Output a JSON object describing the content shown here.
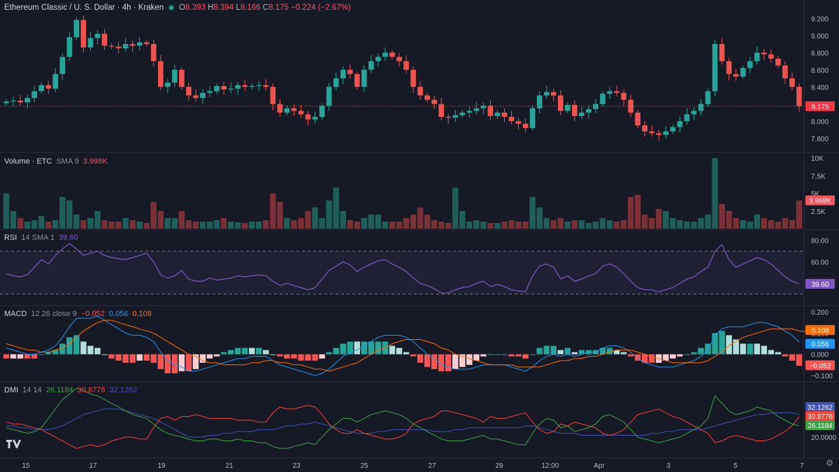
{
  "header": {
    "symbol": "Ethereum Classic / U. S. Dollar · 4h · Kraken",
    "o_label": "O",
    "o_value": "8.393",
    "h_label": "H",
    "h_value": "8.394",
    "l_label": "L",
    "l_value": "8.166",
    "c_label": "C",
    "c_value": "8.175",
    "change": "−0.224 (−2.67%)"
  },
  "volume_legend": {
    "name": "Volume · ETC",
    "param": "SMA 9",
    "value": "3.998K"
  },
  "rsi_legend": {
    "name": "RSI",
    "param": "14 SMA 1",
    "value": "39.60"
  },
  "macd_legend": {
    "name": "MACD",
    "param": "12 26 close 9",
    "v1": "−0.052",
    "v2": "0.056",
    "v3": "0.108"
  },
  "dmi_legend": {
    "name": "DMI",
    "param": "14 14",
    "v1": "26.1184",
    "v2": "30.8776",
    "v3": "32.1262"
  },
  "colors": {
    "background": "#161a25",
    "up": "#26a69a",
    "down": "#ef5350",
    "up_vol": "#1f5f5a",
    "down_vol": "#7b3038",
    "rsi": "#7e57c2",
    "macd": "#2196f3",
    "signal": "#ff6d00",
    "hist_up": "#26a69a",
    "hist_up_weak": "#b2dfdb",
    "hist_dn": "#ff5252",
    "hist_dn_weak": "#ffcdd2",
    "dmi_plus": "#43a047",
    "dmi_minus": "#f44336",
    "adx": "#3f51b5"
  },
  "chart_data": [
    {
      "type": "candlestick",
      "title": "Ethereum Classic / U. S. Dollar · 4h · Kraken",
      "ylim": [
        7.7,
        9.3
      ],
      "yticks": [
        "9.200",
        "9.000",
        "8.800",
        "8.600",
        "8.400",
        "8.200",
        "8.000",
        "7.800"
      ],
      "last_price": "8.175",
      "x_labels": [
        "15",
        "17",
        "19",
        "21",
        "23",
        "25",
        "27",
        "29",
        "12:00",
        "Apr",
        "3",
        "5",
        "7"
      ],
      "close": [
        8.23,
        8.24,
        8.22,
        8.27,
        8.35,
        8.42,
        8.38,
        8.55,
        8.75,
        8.98,
        9.18,
        8.86,
        8.97,
        9.02,
        8.88,
        8.87,
        8.85,
        8.9,
        8.88,
        8.92,
        8.9,
        8.7,
        8.4,
        8.45,
        8.6,
        8.4,
        8.3,
        8.27,
        8.33,
        8.35,
        8.41,
        8.37,
        8.38,
        8.42,
        8.4,
        8.41,
        8.42,
        8.4,
        8.2,
        8.1,
        8.15,
        8.12,
        8.08,
        8.02,
        8.05,
        8.18,
        8.4,
        8.5,
        8.6,
        8.55,
        8.4,
        8.6,
        8.7,
        8.75,
        8.8,
        8.75,
        8.7,
        8.6,
        8.4,
        8.3,
        8.25,
        8.2,
        8.05,
        8.04,
        8.07,
        8.1,
        8.12,
        8.15,
        8.18,
        8.06,
        8.1,
        8.05,
        8.0,
        7.97,
        7.92,
        8.15,
        8.3,
        8.34,
        8.3,
        8.12,
        8.19,
        8.06,
        8.1,
        8.14,
        8.2,
        8.32,
        8.35,
        8.33,
        8.25,
        8.1,
        7.95,
        7.88,
        7.86,
        7.84,
        7.88,
        7.93,
        8.0,
        8.08,
        8.12,
        8.2,
        8.35,
        8.9,
        8.7,
        8.55,
        8.52,
        8.62,
        8.7,
        8.8,
        8.78,
        8.73,
        8.65,
        8.5,
        8.4,
        8.175
      ],
      "volume_max_k": 10.0,
      "volume_k": [
        5.0,
        2.5,
        1.5,
        1.0,
        1.2,
        1.8,
        1.0,
        1.2,
        4.5,
        4.0,
        2.0,
        1.2,
        1.5,
        2.5,
        1.2,
        1.0,
        1.0,
        1.5,
        1.2,
        1.0,
        0.8,
        3.8,
        2.5,
        1.5,
        1.5,
        2.5,
        1.2,
        1.0,
        1.0,
        1.0,
        1.2,
        1.5,
        1.0,
        0.9,
        0.8,
        1.0,
        1.0,
        1.2,
        5.0,
        3.8,
        1.5,
        1.2,
        1.5,
        2.5,
        3.0,
        1.5,
        4.0,
        5.8,
        2.5,
        1.2,
        1.0,
        1.5,
        2.0,
        2.0,
        1.0,
        1.0,
        1.0,
        1.5,
        2.0,
        3.0,
        2.0,
        1.2,
        1.0,
        0.8,
        5.8,
        2.5,
        1.0,
        1.2,
        1.0,
        0.8,
        0.8,
        1.0,
        1.2,
        1.0,
        1.0,
        4.5,
        3.0,
        1.5,
        1.2,
        1.5,
        1.0,
        1.2,
        1.2,
        0.8,
        1.0,
        1.5,
        1.2,
        1.0,
        1.2,
        4.5,
        4.8,
        2.0,
        1.5,
        2.8,
        2.5,
        1.5,
        1.2,
        1.0,
        1.0,
        1.5,
        2.0,
        10.0,
        3.5,
        2.5,
        1.5,
        1.2,
        1.0,
        2.0,
        1.5,
        1.2,
        1.0,
        1.5,
        1.2,
        3.998
      ],
      "volume_yticks": [
        "10K",
        "7.5K",
        "5K",
        "2.5K"
      ]
    },
    {
      "type": "line",
      "name": "RSI",
      "ylim": [
        20,
        85
      ],
      "yticks": [
        "80.00",
        "60.00"
      ],
      "bands": [
        30,
        70
      ],
      "values": [
        49,
        47,
        46,
        48,
        55,
        62,
        58,
        66,
        72,
        77,
        72,
        66,
        68,
        70,
        66,
        64,
        63,
        62,
        64,
        66,
        68,
        60,
        48,
        45,
        47,
        52,
        44,
        42,
        42,
        45,
        43,
        44,
        45,
        47,
        46,
        47,
        48,
        47,
        42,
        38,
        40,
        38,
        36,
        34,
        36,
        44,
        52,
        56,
        60,
        57,
        51,
        55,
        58,
        61,
        62,
        58,
        55,
        51,
        45,
        40,
        38,
        35,
        31,
        31,
        34,
        36,
        37,
        40,
        42,
        37,
        39,
        37,
        34,
        33,
        32,
        47,
        56,
        58,
        55,
        44,
        47,
        42,
        44,
        47,
        49,
        56,
        58,
        55,
        49,
        42,
        36,
        34,
        34,
        32,
        34,
        36,
        40,
        44,
        46,
        51,
        55,
        70,
        76,
        62,
        55,
        58,
        61,
        64,
        62,
        58,
        52,
        46,
        42,
        39.6
      ],
      "last": "39.60"
    },
    {
      "type": "macd",
      "ylim": [
        -0.12,
        0.22
      ],
      "yticks": [
        "0.200",
        "0.100",
        "0.000",
        "−0.100"
      ],
      "macd": [
        0.03,
        0.02,
        0.01,
        0.0,
        0.0,
        0.01,
        0.02,
        0.04,
        0.08,
        0.13,
        0.17,
        0.17,
        0.17,
        0.18,
        0.16,
        0.14,
        0.12,
        0.1,
        0.09,
        0.09,
        0.08,
        0.06,
        0.01,
        -0.03,
        -0.05,
        -0.06,
        -0.08,
        -0.08,
        -0.07,
        -0.06,
        -0.05,
        -0.04,
        -0.03,
        -0.02,
        -0.02,
        -0.01,
        -0.01,
        -0.01,
        -0.03,
        -0.05,
        -0.06,
        -0.07,
        -0.08,
        -0.09,
        -0.1,
        -0.09,
        -0.07,
        -0.04,
        -0.01,
        0.01,
        0.02,
        0.04,
        0.06,
        0.08,
        0.09,
        0.09,
        0.09,
        0.08,
        0.06,
        0.03,
        0.0,
        -0.02,
        -0.05,
        -0.06,
        -0.07,
        -0.07,
        -0.07,
        -0.06,
        -0.05,
        -0.05,
        -0.05,
        -0.05,
        -0.06,
        -0.07,
        -0.08,
        -0.06,
        -0.03,
        -0.01,
        0.0,
        -0.01,
        0.0,
        -0.01,
        0.0,
        0.01,
        0.01,
        0.03,
        0.04,
        0.04,
        0.03,
        0.01,
        -0.02,
        -0.04,
        -0.05,
        -0.06,
        -0.06,
        -0.06,
        -0.05,
        -0.04,
        -0.03,
        -0.01,
        0.02,
        0.09,
        0.12,
        0.13,
        0.13,
        0.13,
        0.14,
        0.15,
        0.15,
        0.14,
        0.13,
        0.11,
        0.09,
        0.056
      ],
      "signal": [
        0.05,
        0.04,
        0.03,
        0.02,
        0.02,
        0.01,
        0.01,
        0.02,
        0.03,
        0.05,
        0.08,
        0.11,
        0.13,
        0.15,
        0.16,
        0.16,
        0.15,
        0.14,
        0.13,
        0.12,
        0.11,
        0.1,
        0.08,
        0.06,
        0.04,
        0.02,
        0.0,
        -0.01,
        -0.03,
        -0.04,
        -0.04,
        -0.05,
        -0.05,
        -0.05,
        -0.05,
        -0.04,
        -0.04,
        -0.03,
        -0.03,
        -0.04,
        -0.04,
        -0.05,
        -0.05,
        -0.06,
        -0.07,
        -0.07,
        -0.08,
        -0.07,
        -0.06,
        -0.05,
        -0.04,
        -0.02,
        0.0,
        0.02,
        0.03,
        0.05,
        0.06,
        0.07,
        0.07,
        0.07,
        0.06,
        0.05,
        0.03,
        0.02,
        0.0,
        -0.01,
        -0.02,
        -0.03,
        -0.04,
        -0.05,
        -0.05,
        -0.05,
        -0.05,
        -0.06,
        -0.06,
        -0.06,
        -0.06,
        -0.05,
        -0.04,
        -0.03,
        -0.03,
        -0.02,
        -0.02,
        -0.01,
        -0.01,
        0.0,
        0.01,
        0.02,
        0.02,
        0.02,
        0.01,
        0.0,
        -0.01,
        -0.02,
        -0.03,
        -0.04,
        -0.04,
        -0.04,
        -0.04,
        -0.04,
        -0.03,
        -0.01,
        0.01,
        0.04,
        0.06,
        0.08,
        0.09,
        0.1,
        0.11,
        0.12,
        0.12,
        0.12,
        0.12,
        0.11,
        0.108
      ],
      "last_macd": "0.056",
      "last_signal": "0.108",
      "last_hist": "−0.052"
    },
    {
      "type": "line",
      "name": "DMI",
      "ylim": [
        10,
        48
      ],
      "yticks": [
        "20.0000"
      ],
      "plus": [
        25,
        24,
        23,
        22,
        23,
        25,
        30,
        35,
        40,
        43,
        46,
        45,
        43,
        42,
        40,
        38,
        36,
        34,
        32,
        31,
        30,
        27,
        24,
        22,
        21,
        20,
        19,
        18,
        18,
        19,
        19,
        18,
        18,
        19,
        18,
        18,
        17,
        17,
        15,
        14,
        14,
        15,
        16,
        17,
        16,
        20,
        24,
        27,
        30,
        30,
        28,
        30,
        32,
        33,
        34,
        33,
        32,
        30,
        27,
        25,
        23,
        21,
        19,
        18,
        18,
        18,
        19,
        20,
        21,
        19,
        19,
        18,
        17,
        16,
        16,
        22,
        27,
        30,
        29,
        25,
        26,
        23,
        24,
        25,
        27,
        31,
        32,
        30,
        28,
        24,
        20,
        19,
        18,
        17,
        18,
        19,
        20,
        22,
        24,
        26,
        30,
        42,
        38,
        34,
        32,
        33,
        34,
        36,
        35,
        34,
        31,
        29,
        27,
        26.1
      ],
      "minus": [
        28,
        27,
        27,
        26,
        25,
        24,
        22,
        20,
        18,
        16,
        14,
        15,
        16,
        15,
        16,
        18,
        19,
        20,
        20,
        19,
        19,
        25,
        30,
        31,
        29,
        31,
        31,
        32,
        31,
        30,
        30,
        30,
        30,
        29,
        29,
        29,
        28,
        28,
        33,
        36,
        35,
        35,
        36,
        37,
        36,
        32,
        27,
        24,
        22,
        22,
        24,
        22,
        21,
        20,
        19,
        19,
        20,
        22,
        27,
        29,
        30,
        31,
        34,
        34,
        33,
        32,
        31,
        30,
        28,
        31,
        30,
        30,
        31,
        32,
        33,
        28,
        24,
        22,
        23,
        27,
        26,
        28,
        27,
        26,
        25,
        22,
        21,
        22,
        24,
        28,
        32,
        33,
        34,
        35,
        33,
        31,
        30,
        28,
        26,
        24,
        22,
        17,
        18,
        20,
        21,
        20,
        19,
        18,
        18,
        19,
        21,
        23,
        26,
        30.9
      ],
      "adx": [
        26,
        26,
        25,
        25,
        24,
        24,
        24,
        25,
        26,
        28,
        30,
        32,
        33,
        34,
        35,
        35,
        35,
        34,
        33,
        32,
        31,
        30,
        28,
        26,
        24,
        22,
        20,
        20,
        20,
        21,
        21,
        22,
        22,
        23,
        23,
        23,
        24,
        24,
        24,
        25,
        26,
        26,
        27,
        27,
        28,
        27,
        26,
        25,
        24,
        23,
        22,
        22,
        22,
        23,
        23,
        24,
        24,
        24,
        24,
        24,
        24,
        23,
        23,
        23,
        24,
        24,
        25,
        25,
        25,
        25,
        25,
        25,
        25,
        25,
        26,
        26,
        25,
        24,
        23,
        22,
        22,
        22,
        21,
        21,
        21,
        21,
        21,
        21,
        21,
        21,
        21,
        21,
        22,
        22,
        23,
        23,
        24,
        24,
        24,
        24,
        25,
        26,
        27,
        28,
        29,
        30,
        31,
        32,
        32,
        33,
        33,
        33,
        33,
        32.1
      ],
      "last_plus": "26.1184",
      "last_minus": "30.8776",
      "last_adx": "32.1262"
    }
  ]
}
